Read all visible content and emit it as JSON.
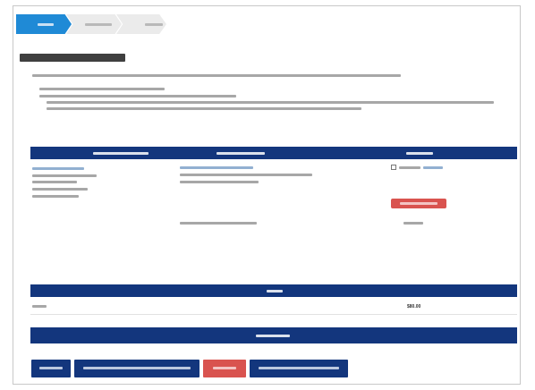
{
  "cart": {
    "total_value": "$80.00"
  },
  "colors": {
    "primary": "#13367d",
    "step_active": "#1f8ad6",
    "danger": "#d9534f"
  }
}
